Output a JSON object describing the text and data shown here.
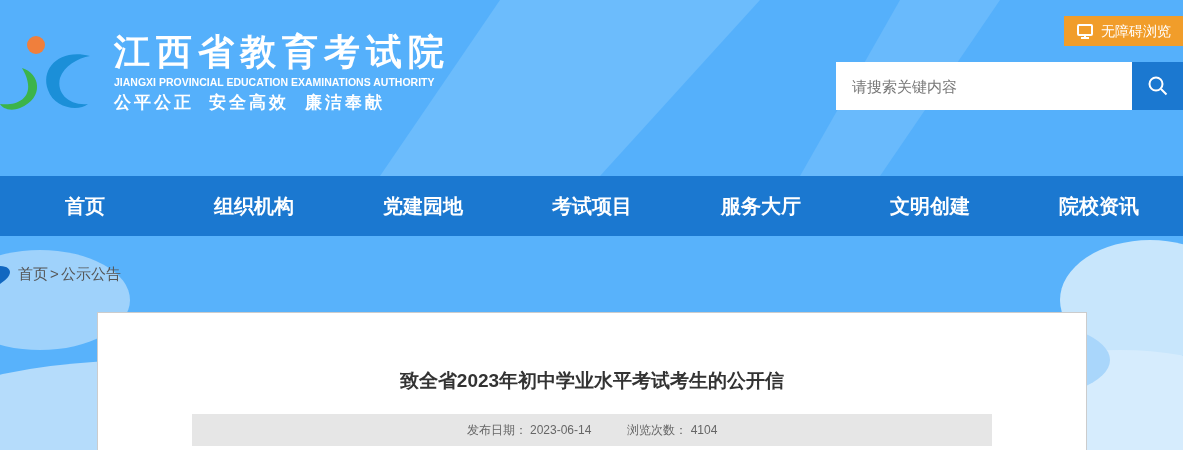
{
  "header": {
    "title": "江西省教育考试院",
    "subtitle": "JIANGXI PROVINCIAL EDUCATION EXAMINATIONS AUTHORITY",
    "motto": "公平公正  安全高效  廉洁奉献",
    "accessibility_button": "无障碍浏览",
    "search": {
      "placeholder": "请搜索关键内容"
    }
  },
  "nav": [
    "首页",
    "组织机构",
    "党建园地",
    "考试项目",
    "服务大厅",
    "文明创建",
    "院校资讯"
  ],
  "breadcrumb": [
    "首页",
    ">",
    "公示公告"
  ],
  "article": {
    "title": "致全省2023年初中学业水平考试考生的公开信",
    "meta": [
      {
        "label": "发布日期：",
        "value": "2023-06-14"
      },
      {
        "label": "浏览次数：",
        "value": "4104"
      }
    ]
  }
}
